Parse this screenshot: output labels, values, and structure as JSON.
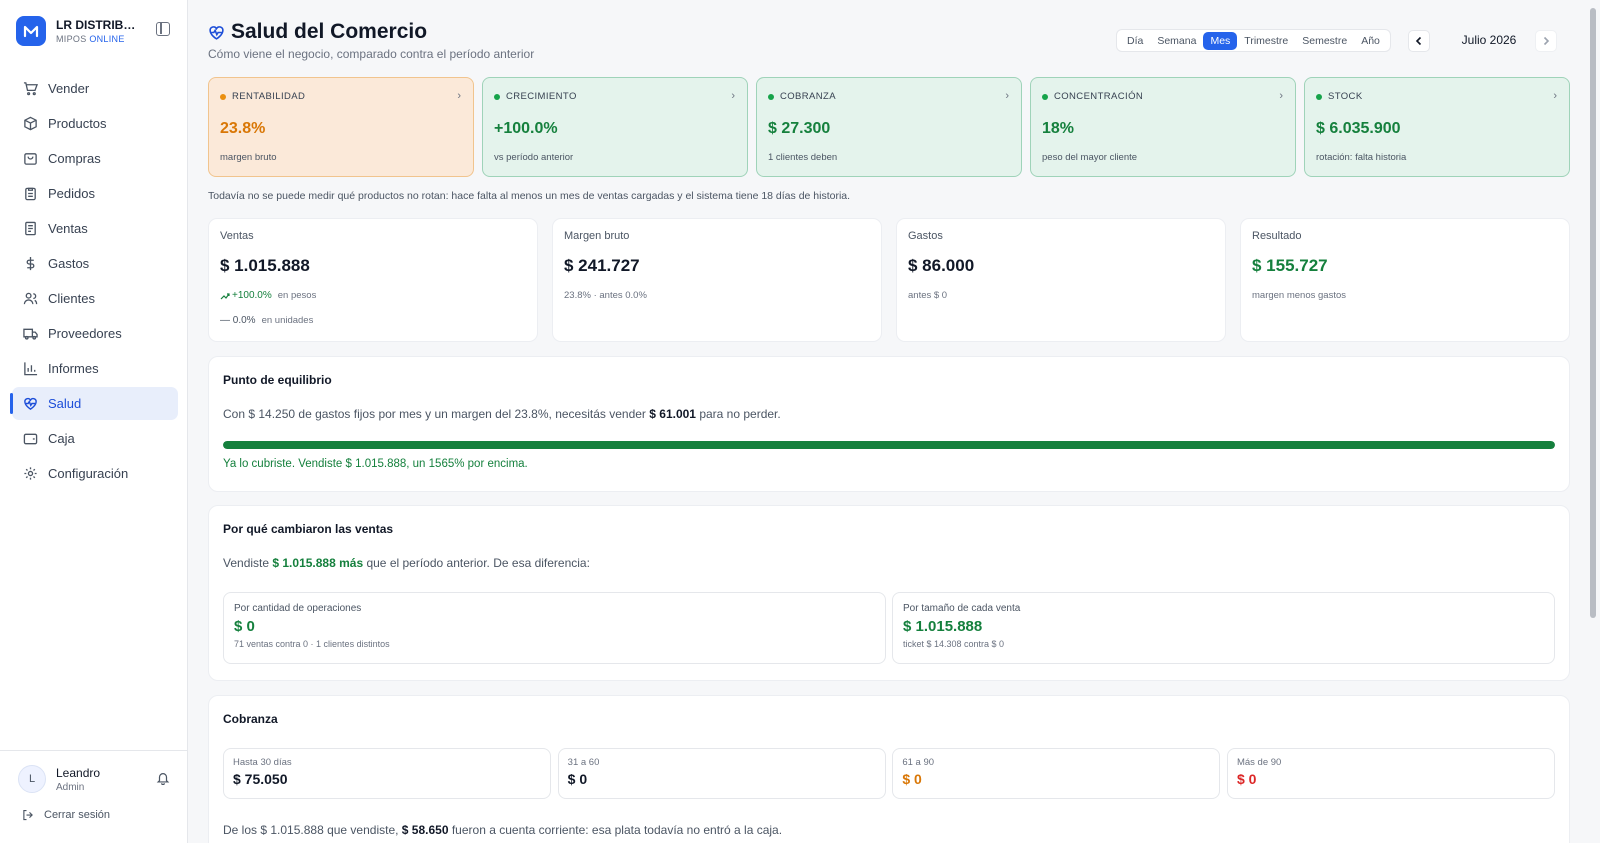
{
  "brand": {
    "name": "LR DISTRIBUID...",
    "sub_prefix": "MIPOS",
    "sub_online": "ONLINE"
  },
  "sidebar": {
    "items": [
      {
        "label": "Vender",
        "icon": "cart-icon"
      },
      {
        "label": "Productos",
        "icon": "box-icon"
      },
      {
        "label": "Compras",
        "icon": "shopping-bag-icon"
      },
      {
        "label": "Pedidos",
        "icon": "clipboard-icon"
      },
      {
        "label": "Ventas",
        "icon": "receipt-icon"
      },
      {
        "label": "Gastos",
        "icon": "dollar-icon"
      },
      {
        "label": "Clientes",
        "icon": "users-icon"
      },
      {
        "label": "Proveedores",
        "icon": "truck-icon"
      },
      {
        "label": "Informes",
        "icon": "bar-chart-icon"
      },
      {
        "label": "Salud",
        "icon": "heart-pulse-icon",
        "active": true
      },
      {
        "label": "Caja",
        "icon": "wallet-icon"
      },
      {
        "label": "Configuración",
        "icon": "gear-icon"
      }
    ]
  },
  "user": {
    "initial": "L",
    "name": "Leandro",
    "role": "Admin",
    "logout_label": "Cerrar sesión"
  },
  "header": {
    "title": "Salud del Comercio",
    "subtitle": "Cómo viene el negocio, comparado contra el período anterior",
    "periods": [
      "Día",
      "Semana",
      "Mes",
      "Trimestre",
      "Semestre",
      "Año"
    ],
    "active_period": "Mes",
    "current_period": "Julio 2026"
  },
  "kpis": [
    {
      "label": "RENTABILIDAD",
      "value": "23.8%",
      "note": "margen bruto",
      "status": "warn"
    },
    {
      "label": "CRECIMIENTO",
      "value": "+100.0%",
      "note": "vs período anterior",
      "status": "ok"
    },
    {
      "label": "COBRANZA",
      "value": "$ 27.300",
      "note": "1 clientes deben",
      "status": "ok"
    },
    {
      "label": "CONCENTRACIÓN",
      "value": "18%",
      "note": "peso del mayor cliente",
      "status": "ok"
    },
    {
      "label": "STOCK",
      "value": "$ 6.035.900",
      "note": "rotación: falta historia",
      "status": "ok"
    }
  ],
  "notice": "Todavía no se puede medir qué productos no rotan: hace falta al menos un mes de ventas cargadas y el sistema tiene 18 días de historia.",
  "metrics": {
    "ventas": {
      "label": "Ventas",
      "value": "$ 1.015.888",
      "change_pesos": "+100.0%",
      "change_pesos_label": "en pesos",
      "change_units": "— 0.0%",
      "change_units_label": "en unidades"
    },
    "margen": {
      "label": "Margen bruto",
      "value": "$ 241.727",
      "sub": "23.8% · antes 0.0%"
    },
    "gastos": {
      "label": "Gastos",
      "value": "$ 86.000",
      "sub": "antes $ 0"
    },
    "resultado": {
      "label": "Resultado",
      "value": "$ 155.727",
      "sub": "margen menos gastos"
    }
  },
  "breakeven": {
    "title": "Punto de equilibrio",
    "text_before": "Con $ 14.250 de gastos fijos por mes y un margen del 23.8%, necesitás vender ",
    "amount": "$ 61.001",
    "text_after": " para no perder.",
    "progress_pct": 100,
    "status_text": "Ya lo cubriste. Vendiste $ 1.015.888, un 1565% por encima."
  },
  "sales_change": {
    "title": "Por qué cambiaron las ventas",
    "text_before": "Vendiste ",
    "amount": "$ 1.015.888 más",
    "text_after": " que el período anterior. De esa diferencia:",
    "by_count": {
      "label": "Por cantidad de operaciones",
      "value": "$ 0",
      "note": "71 ventas contra 0 · 1 clientes distintos"
    },
    "by_ticket": {
      "label": "Por tamaño de cada venta",
      "value": "$ 1.015.888",
      "note": "ticket $ 14.308 contra $ 0"
    }
  },
  "collections": {
    "title": "Cobranza",
    "buckets": [
      {
        "label": "Hasta 30 días",
        "value": "$ 75.050"
      },
      {
        "label": "31 a 60",
        "value": "$ 0"
      },
      {
        "label": "61 a 90",
        "value": "$ 0"
      },
      {
        "label": "Más de 90",
        "value": "$ 0"
      }
    ],
    "text_before": "De los $ 1.015.888 que vendiste, ",
    "amount": "$ 58.650",
    "text_after": " fueron a cuenta corriente: esa plata todavía no entró a la caja."
  },
  "colors": {
    "accent": "#2563eb",
    "ok": "#15803d",
    "warn": "#d97706",
    "danger": "#dc2626"
  }
}
